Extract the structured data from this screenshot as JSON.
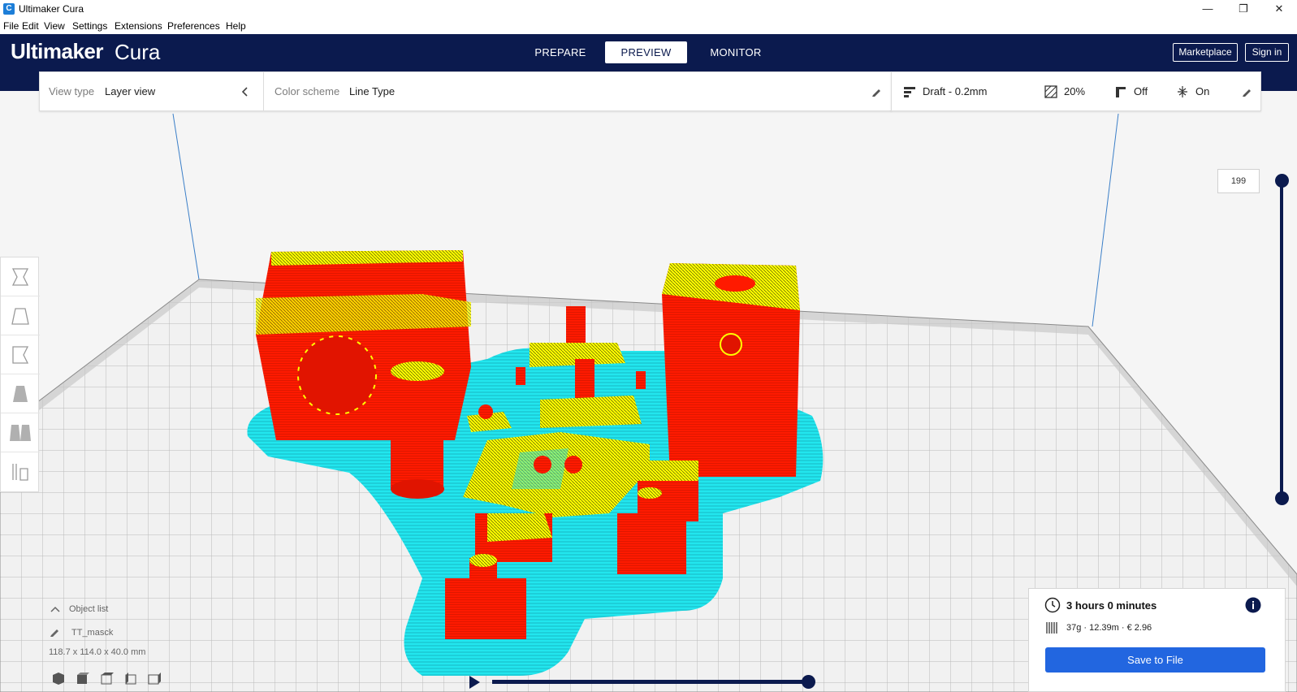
{
  "window": {
    "title": "Ultimaker Cura",
    "icon_letter": "C",
    "minimize": "—",
    "maximize": "❐",
    "close": "✕"
  },
  "menu": [
    "File",
    "Edit",
    "View",
    "Settings",
    "Extensions",
    "Preferences",
    "Help"
  ],
  "header": {
    "brand_bold": "Ultimaker",
    "brand_light": "Cura",
    "tabs": [
      {
        "label": "PREPARE",
        "active": false
      },
      {
        "label": "PREVIEW",
        "active": true
      },
      {
        "label": "MONITOR",
        "active": false
      }
    ],
    "marketplace": "Marketplace",
    "signin": "Sign in"
  },
  "view_panel": {
    "view_type_label": "View type",
    "view_type_value": "Layer view",
    "color_scheme_label": "Color scheme",
    "color_scheme_value": "Line Type"
  },
  "print_settings": {
    "profile": "Draft - 0.2mm",
    "infill": "20%",
    "support": "Off",
    "adhesion": "On"
  },
  "layer_slider": {
    "current_layer": "199"
  },
  "object_info": {
    "object_list_label": "Object list",
    "object_name": "TT_masck",
    "dimensions": "118.7 x 114.0 x 40.0 mm"
  },
  "print_card": {
    "time": "3 hours 0 minutes",
    "material": "37g · 12.39m · € 2.96",
    "save_label": "Save to File"
  },
  "colors": {
    "header_bg": "#0b1a4e",
    "wall": "#ff1a00",
    "infill": "#ffff00",
    "skirt": "#22e6ee",
    "primary_button": "#2266e0"
  }
}
